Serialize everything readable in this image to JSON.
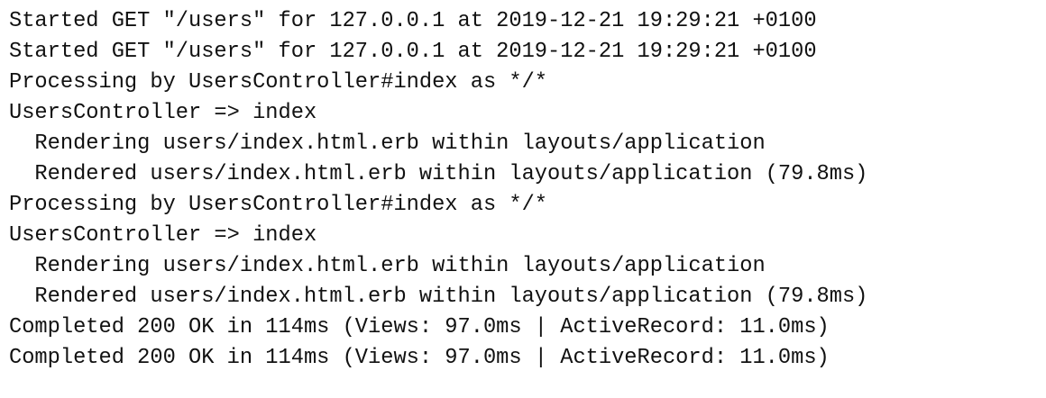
{
  "log_lines": [
    "Started GET \"/users\" for 127.0.0.1 at 2019-12-21 19:29:21 +0100",
    "Started GET \"/users\" for 127.0.0.1 at 2019-12-21 19:29:21 +0100",
    "Processing by UsersController#index as */*",
    "UsersController => index",
    "  Rendering users/index.html.erb within layouts/application",
    "  Rendered users/index.html.erb within layouts/application (79.8ms)",
    "Processing by UsersController#index as */*",
    "UsersController => index",
    "  Rendering users/index.html.erb within layouts/application",
    "  Rendered users/index.html.erb within layouts/application (79.8ms)",
    "Completed 200 OK in 114ms (Views: 97.0ms | ActiveRecord: 11.0ms)",
    "Completed 200 OK in 114ms (Views: 97.0ms | ActiveRecord: 11.0ms)"
  ]
}
